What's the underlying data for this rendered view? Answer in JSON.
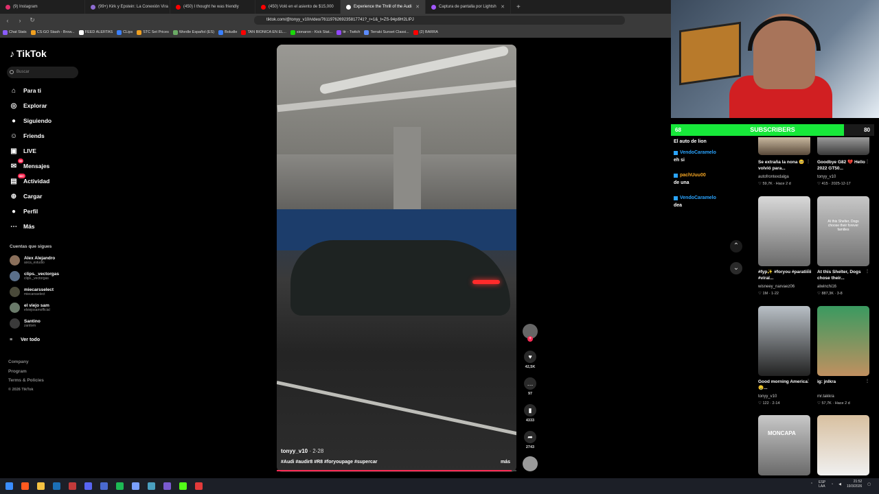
{
  "browser": {
    "tabs": [
      {
        "label": "(9) Instagram",
        "color": "#e1306c"
      },
      {
        "label": "(99+) Kirk y Epstein: La Conexión Vira",
        "color": "#8d6bd1"
      },
      {
        "label": "(450) I thought he was friendly",
        "color": "#ff0000"
      },
      {
        "label": "(450) Voló en el asiento de $15,000",
        "color": "#ff0000"
      },
      {
        "label": "Experience the Thrill of the Audi",
        "color": "#ffffff"
      },
      {
        "label": "Captura de pantalla por Lightsh",
        "color": "#a257ff"
      }
    ],
    "url": "tiktok.com/@tonyy_v10/video/7611976269235817741?_r=1&_t=ZS-94pi9H2LIPJ",
    "bookmarks": [
      {
        "label": "Chat Stats",
        "color": "#8a5cff"
      },
      {
        "label": "CS:GO Stash - Brow...",
        "color": "#f0a020"
      },
      {
        "label": "FEED ALERTAS",
        "color": "#ffffff"
      },
      {
        "label": "CLips",
        "color": "#3a80ff"
      },
      {
        "label": "STC Set Prices",
        "color": "#f0a020"
      },
      {
        "label": "Wordle Español (ES)",
        "color": "#6aaa64"
      },
      {
        "label": "Boludle",
        "color": "#3a80ff"
      },
      {
        "label": "TAN BIONICA EN EL...",
        "color": "#ff0000"
      },
      {
        "label": "sionaron - Kick Stat...",
        "color": "#1ad80a"
      },
      {
        "label": "ttr - Twitch",
        "color": "#9146ff"
      },
      {
        "label": "Terraki Sunset Classi...",
        "color": "#5c8cff"
      },
      {
        "label": "(2) BARRA",
        "color": "#ff0000"
      }
    ]
  },
  "tiktok": {
    "logo": "TikTok",
    "search_placeholder": "Buscar",
    "nav": [
      {
        "label": "Para ti",
        "icon": "home-icon",
        "glyph": "⌂"
      },
      {
        "label": "Explorar",
        "icon": "compass-icon",
        "glyph": "◎"
      },
      {
        "label": "Siguiendo",
        "icon": "following-icon",
        "glyph": "●"
      },
      {
        "label": "Friends",
        "icon": "friends-icon",
        "glyph": "☺"
      },
      {
        "label": "LIVE",
        "icon": "live-icon",
        "glyph": "▣"
      },
      {
        "label": "Mensajes",
        "icon": "messages-icon",
        "glyph": "✉",
        "badge": "55"
      },
      {
        "label": "Actividad",
        "icon": "activity-icon",
        "glyph": "▤",
        "badge": "99+"
      },
      {
        "label": "Cargar",
        "icon": "upload-icon",
        "glyph": "⊕"
      },
      {
        "label": "Perfil",
        "icon": "profile-icon",
        "glyph": "●"
      },
      {
        "label": "Más",
        "icon": "more-icon",
        "glyph": "⋯"
      }
    ],
    "following_title": "Cuentas que sigues",
    "following": [
      {
        "name": "Alex Alejandro",
        "handle": "aoca_estudio"
      },
      {
        "name": "clips._vectorgas",
        "handle": "clips._vectorgas"
      },
      {
        "name": "miecarsselect",
        "handle": "miecarsselect"
      },
      {
        "name": "el viejo sam",
        "handle": "elviejosamofficial"
      },
      {
        "name": "Santino",
        "handle": "zantivm"
      }
    ],
    "see_all": "Ver todo",
    "footer": [
      "Company",
      "Program",
      "Terms & Policies",
      "© 2026 TikTok"
    ],
    "video": {
      "author": "tonyy_v10",
      "date": "· 2-28",
      "tags": "#Audi #audir8 #R8 #foryoupage #supercar",
      "more": "más",
      "progress": 0.98
    },
    "actions": {
      "likes": "42,5K",
      "comments": "97",
      "saves": "4333",
      "shares": "2743"
    },
    "related": [
      {
        "title": "Se extraña la nona 🥺 volvió para...",
        "author": "autofrontexdalga",
        "stats": "♡ 59,7K · Hace 2 d"
      },
      {
        "title": "Goodbye G82 💔 Hello 2022 GT50...",
        "author": "tonyy_v10",
        "stats": "♡ 415 · 2025-12-17"
      },
      {
        "title": "#fyp✨ #foryou #paratiiiii #viral...",
        "author": "wisneey_narvaez06",
        "stats": "♡ 1M · 1-22"
      },
      {
        "title": "At this Shelter, Dogs chose their...",
        "author": "alwinchi16",
        "stats": "♡ 887,3K · 3-8"
      },
      {
        "title": "Good morning America 🤤...",
        "author": "tonyy_v10",
        "stats": "♡ 122 · 2-14"
      },
      {
        "title": "ig: jnlkra",
        "author": "mr.takkra",
        "stats": "♡ 57,7K · Hace 2 d"
      }
    ],
    "thumb_overlays": {
      "shelter": "At this Shelter, Dogs choose their forever families",
      "beanie": "MONCAPA"
    }
  },
  "stream": {
    "sub_left": "68",
    "sub_label": "SUBSCRIBERS",
    "sub_right": "80",
    "sub_progress": 0.85,
    "chat": [
      {
        "user": "",
        "msg": "El auto de lion"
      },
      {
        "user": "VendoCaramelo",
        "msg": "eh si",
        "color": "#2aa4ff"
      },
      {
        "user": "pachUuu00",
        "msg": "de una",
        "color": "#f5a623"
      },
      {
        "user": "VendoCaramelo",
        "msg": "dea",
        "color": "#2aa4ff"
      }
    ]
  },
  "system": {
    "lang": "ESP\nLAA",
    "time": "21:52",
    "date": "19/3/2026"
  }
}
